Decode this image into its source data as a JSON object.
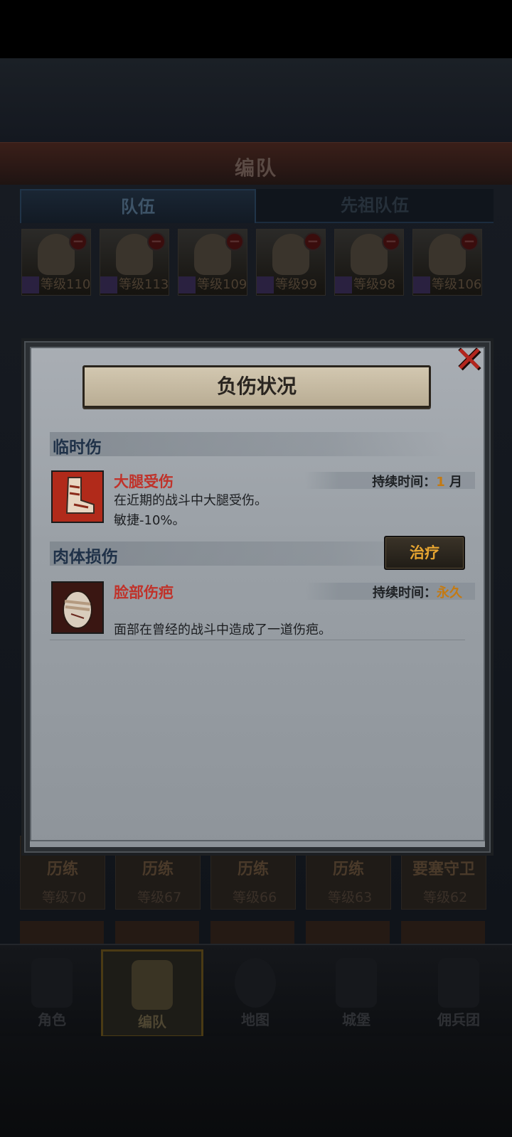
{
  "header": {
    "title": "编队"
  },
  "tabs": [
    {
      "label": "队伍"
    },
    {
      "label": "先祖队伍"
    }
  ],
  "team": [
    {
      "level": "等级110"
    },
    {
      "level": "等级113"
    },
    {
      "level": "等级109"
    },
    {
      "level": "等级99"
    },
    {
      "level": "等级98"
    },
    {
      "level": "等级106"
    }
  ],
  "roster": [
    {
      "status": "历练",
      "level": "等级70"
    },
    {
      "status": "历练",
      "level": "等级67"
    },
    {
      "status": "历练",
      "level": "等级66"
    },
    {
      "status": "历练",
      "level": "等级63"
    },
    {
      "status": "要塞守卫",
      "level": "等级62"
    }
  ],
  "nav": [
    {
      "label": "角色"
    },
    {
      "label": "编队"
    },
    {
      "label": "地图"
    },
    {
      "label": "城堡"
    },
    {
      "label": "佣兵团"
    }
  ],
  "modal": {
    "title": "负伤状况",
    "sections": [
      {
        "heading": "临时伤",
        "injury": {
          "name": "大腿受伤",
          "duration_label": "持续时间：",
          "duration_value": "1",
          "duration_unit": "月",
          "desc_lines": [
            "在近期的战斗中大腿受伤。",
            "敏捷-10%。"
          ]
        }
      },
      {
        "heading": "肉体损伤",
        "action_label": "治疗",
        "injury": {
          "name": "脸部伤疤",
          "duration_label": "持续时间：",
          "duration_value": "永久",
          "desc_lines": [
            "面部在曾经的战斗中造成了一道伤疤。"
          ]
        }
      }
    ]
  },
  "colors": {
    "injury_name": "#c0322a",
    "duration_value": "#c47a12",
    "treat_text": "#e7a531",
    "close_x": "#b3261e"
  }
}
